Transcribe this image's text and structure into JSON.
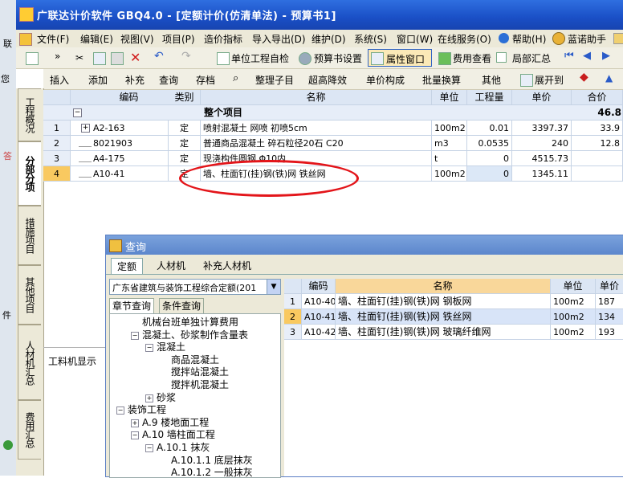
{
  "window": {
    "title": "广联达计价软件 GBQ4.0 - [定额计价(仿清单法) - 预算书1]"
  },
  "menu": [
    "文件(F)",
    "编辑(E)",
    "视图(V)",
    "项目(P)",
    "造价指标",
    "导入导出(D)",
    "维护(D)",
    "系统(S)",
    "窗口(W)",
    "在线服务(O)",
    "帮助(H)",
    "蓝诺助手"
  ],
  "toolbar1": {
    "check": "单位工程自检",
    "budget_settings": "预算书设置",
    "property_window": "属性窗口",
    "fee_view": "费用查看",
    "partial_summary": "局部汇总"
  },
  "toolbar2": [
    "插入",
    "添加",
    "补充",
    "查询",
    "存档",
    "整理子目",
    "超高降效",
    "单价构成",
    "批量换算",
    "其他",
    "展开到"
  ],
  "vertical_tabs": [
    "工程概况",
    "分部分项",
    "措施项目",
    "其他项目",
    "人材机汇总",
    "费用汇总"
  ],
  "left_strip_text": [
    "联",
    "您",
    "答",
    "件"
  ],
  "grid": {
    "headers": [
      "编码",
      "类别",
      "名称",
      "单位",
      "工程量",
      "单价",
      "合价"
    ],
    "summary_row": {
      "name": "整个项目",
      "total": "46.8"
    },
    "rows": [
      {
        "num": "1",
        "code": "A2-163",
        "type": "定",
        "name": "喷射混凝土 网喷 初喷5cm",
        "unit": "100m2",
        "qty": "0.01",
        "price": "3397.37",
        "total": "33.9"
      },
      {
        "num": "2",
        "code": "8021903",
        "type": "定",
        "name": "普通商品混凝土 碎石粒径20石 C20",
        "unit": "m3",
        "qty": "0.0535",
        "price": "240",
        "total": "12.8"
      },
      {
        "num": "3",
        "code": "A4-175",
        "type": "定",
        "name": "现浇构件圆钢 Φ10内",
        "unit": "t",
        "qty": "0",
        "price": "4515.73",
        "total": ""
      },
      {
        "num": "4",
        "code": "A10-41",
        "type": "定",
        "name": "墙、柱面钉(挂)钢(铁)网 铁丝网",
        "unit": "100m2",
        "qty": "0",
        "price": "1345.11",
        "total": ""
      }
    ]
  },
  "lower_panel": {
    "label": "工料机显示"
  },
  "dialog": {
    "title": "查询",
    "tabs": [
      "定额",
      "人材机",
      "补充人材机"
    ],
    "combo_value": "广东省建筑与装饰工程综合定额(201",
    "sub_tabs": [
      "章节查询",
      "条件查询"
    ],
    "tree": [
      {
        "label": "机械台班单独计算费用",
        "indent": 1,
        "box": ""
      },
      {
        "label": "混凝土、砂浆制作含量表",
        "indent": 1,
        "box": "-"
      },
      {
        "label": "混凝土",
        "indent": 2,
        "box": "-"
      },
      {
        "label": "商品混凝土",
        "indent": 3,
        "box": ""
      },
      {
        "label": "搅拌站混凝土",
        "indent": 3,
        "box": ""
      },
      {
        "label": "搅拌机混凝土",
        "indent": 3,
        "box": ""
      },
      {
        "label": "砂浆",
        "indent": 2,
        "box": "+"
      },
      {
        "label": "装饰工程",
        "indent": 0,
        "box": "-"
      },
      {
        "label": "A.9 楼地面工程",
        "indent": 1,
        "box": "+"
      },
      {
        "label": "A.10 墙柱面工程",
        "indent": 1,
        "box": "-"
      },
      {
        "label": "A.10.1 抹灰",
        "indent": 2,
        "box": "-"
      },
      {
        "label": "A.10.1.1 底层抹灰",
        "indent": 3,
        "box": ""
      },
      {
        "label": "A.10.1.2 一般抹灰",
        "indent": 3,
        "box": ""
      }
    ],
    "results": {
      "headers": [
        "编码",
        "名称",
        "单位",
        "单价"
      ],
      "rows": [
        {
          "num": "1",
          "code": "A10-40",
          "name": "墙、柱面钉(挂)钢(铁)网 钢板网",
          "unit": "100m2",
          "price": "187"
        },
        {
          "num": "2",
          "code": "A10-41",
          "name": "墙、柱面钉(挂)钢(铁)网 铁丝网",
          "unit": "100m2",
          "price": "134"
        },
        {
          "num": "3",
          "code": "A10-42",
          "name": "墙、柱面钉(挂)钢(铁)网 玻璃纤维网",
          "unit": "100m2",
          "price": "193"
        }
      ]
    }
  }
}
